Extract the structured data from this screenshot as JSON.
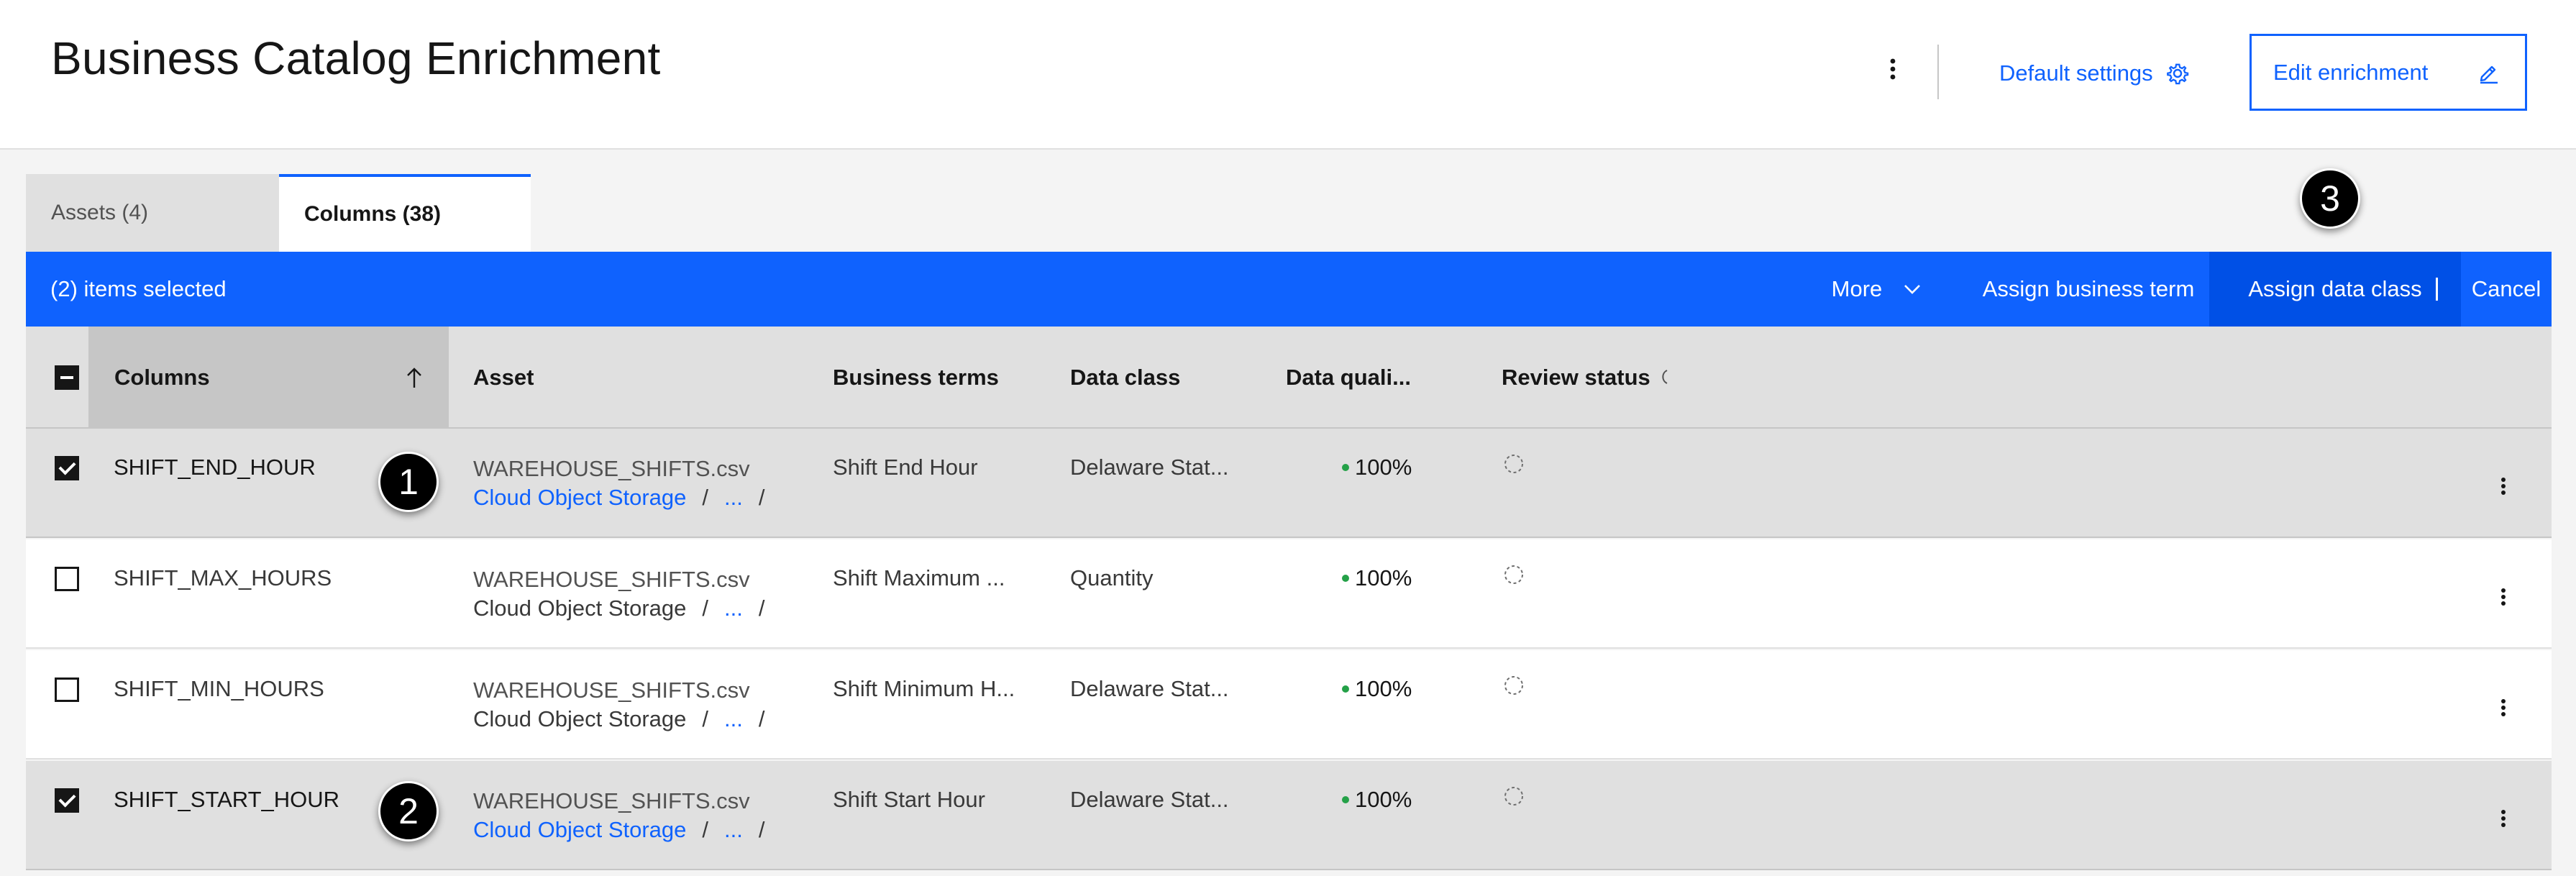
{
  "header": {
    "title": "Business Catalog Enrichment",
    "default_settings_label": "Default settings",
    "edit_enrichment_label": "Edit enrichment"
  },
  "tabs": [
    {
      "label": "Assets (4)",
      "active": false
    },
    {
      "label": "Columns (38)",
      "active": true
    }
  ],
  "action_bar": {
    "selected_text": "(2) items selected",
    "more_label": "More",
    "assign_term_label": "Assign business term",
    "assign_class_label": "Assign data class",
    "cancel_label": "Cancel",
    "color": "#0f62fe"
  },
  "table": {
    "headers": {
      "columns": "Columns",
      "asset": "Asset",
      "business_terms": "Business terms",
      "data_class": "Data class",
      "data_quality": "Data quali...",
      "review_status": "Review status"
    },
    "rows": [
      {
        "selected": true,
        "name": "SHIFT_END_HOUR",
        "asset_file": "WAREHOUSE_SHIFTS.csv",
        "asset_location": "Cloud Object Storage",
        "asset_location_link": true,
        "path_sep": "/",
        "path_ellipsis": "...",
        "business_term": "Shift End Hour",
        "data_class": "Delaware Stat...",
        "quality": "100%"
      },
      {
        "selected": false,
        "name": "SHIFT_MAX_HOURS",
        "asset_file": "WAREHOUSE_SHIFTS.csv",
        "asset_location": "Cloud Object Storage",
        "asset_location_link": false,
        "path_sep": "/",
        "path_ellipsis": "...",
        "business_term": "Shift Maximum ...",
        "data_class": "Quantity",
        "quality": "100%"
      },
      {
        "selected": false,
        "name": "SHIFT_MIN_HOURS",
        "asset_file": "WAREHOUSE_SHIFTS.csv",
        "asset_location": "Cloud Object Storage",
        "asset_location_link": false,
        "path_sep": "/",
        "path_ellipsis": "...",
        "business_term": "Shift Minimum H...",
        "data_class": "Delaware Stat...",
        "quality": "100%"
      },
      {
        "selected": true,
        "name": "SHIFT_START_HOUR",
        "asset_file": "WAREHOUSE_SHIFTS.csv",
        "asset_location": "Cloud Object Storage",
        "asset_location_link": true,
        "path_sep": "/",
        "path_ellipsis": "...",
        "business_term": "Shift Start Hour",
        "data_class": "Delaware Stat...",
        "quality": "100%"
      }
    ]
  },
  "callouts": [
    "1",
    "2",
    "3"
  ],
  "icons": {
    "overflow": "overflow-menu-vertical-icon",
    "settings": "gear-icon",
    "edit": "pencil-icon",
    "sort": "arrow-up-icon",
    "chevron": "chevron-down-icon",
    "review_pending": "dashed-circle-icon"
  },
  "colors": {
    "accent": "#0f62fe",
    "quality_ok": "#24a148",
    "selected_row": "#e0e0e0"
  }
}
